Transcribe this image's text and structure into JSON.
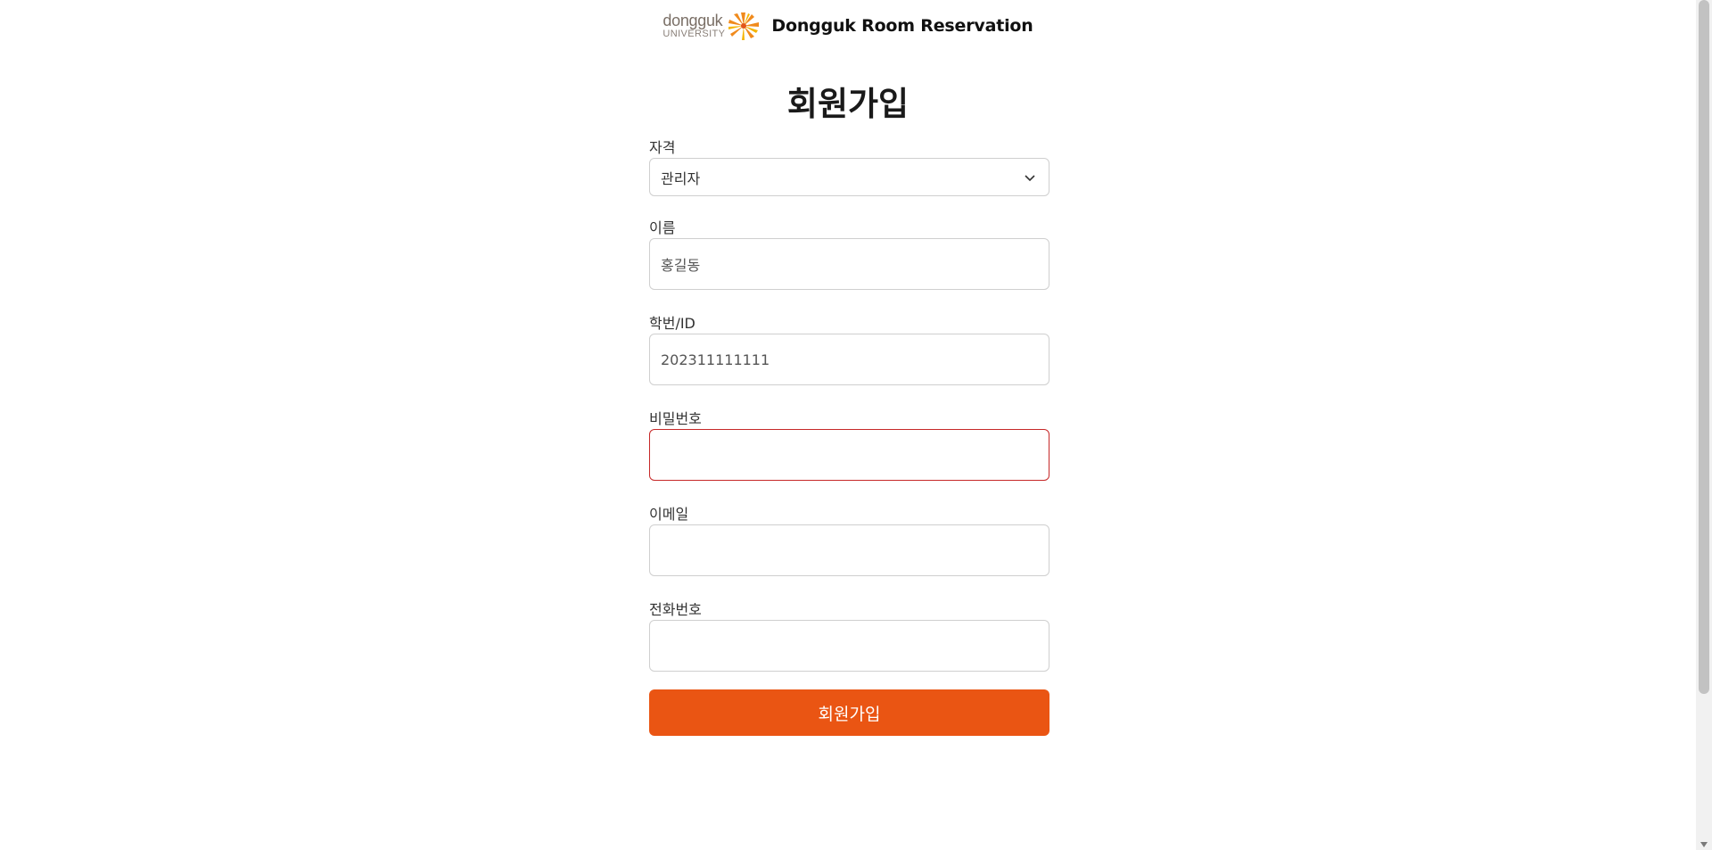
{
  "header": {
    "logo_main": "dongguk",
    "logo_sub": "UNIVERSITY",
    "title": "Dongguk Room Reservation"
  },
  "page": {
    "title": "회원가입"
  },
  "form": {
    "role": {
      "label": "자격",
      "value": "관리자"
    },
    "name": {
      "label": "이름",
      "value": "홍길동"
    },
    "student_id": {
      "label": "학번/ID",
      "value": "202311111111"
    },
    "password": {
      "label": "비밀번호",
      "value": ""
    },
    "email": {
      "label": "이메일",
      "value": ""
    },
    "phone": {
      "label": "전화번호",
      "value": ""
    },
    "submit_label": "회원가입"
  },
  "colors": {
    "accent": "#ea5513",
    "error_border": "#c62828",
    "logo_orange": "#f08a1c"
  }
}
